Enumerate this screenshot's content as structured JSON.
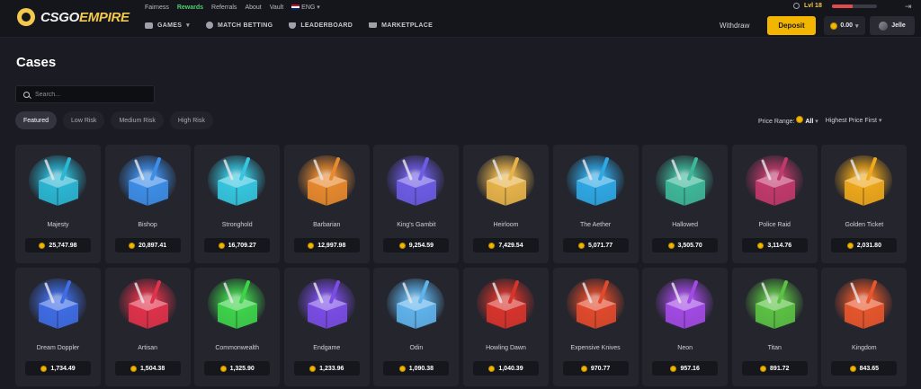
{
  "brand": {
    "name_part1": "CSGO",
    "name_part2": "EMPIRE",
    "accent": "#f2c94c"
  },
  "util_links": {
    "fairness": "Fairness",
    "rewards": "Rewards",
    "referrals": "Referrals",
    "about": "About",
    "vault": "Vault",
    "language": "ENG"
  },
  "nav": {
    "games": "GAMES",
    "match_betting": "MATCH BETTING",
    "leaderboard": "LEADERBOARD",
    "marketplace": "MARKETPLACE"
  },
  "account": {
    "level": "Lvl 18",
    "level_progress": 0.45,
    "withdraw": "Withdraw",
    "deposit": "Deposit",
    "balance": "0.00",
    "username": "Jelle"
  },
  "page": {
    "title": "Cases",
    "search_placeholder": "Search...",
    "filters": [
      "Featured",
      "Low Risk",
      "Medium Risk",
      "High Risk"
    ],
    "active_filter": "Featured",
    "price_range_label": "Price Range:",
    "price_range_value": "All",
    "sort_label": "Highest Price First"
  },
  "cases": [
    {
      "name": "Majesty",
      "price": "25,747.98",
      "color": "#2bb7d4"
    },
    {
      "name": "Bishop",
      "price": "20,897.41",
      "color": "#3d8ee8"
    },
    {
      "name": "Stronghold",
      "price": "16,709.27",
      "color": "#36c6e0"
    },
    {
      "name": "Barbarian",
      "price": "12,997.98",
      "color": "#e88a2e"
    },
    {
      "name": "King's Gambit",
      "price": "9,254.59",
      "color": "#6d5ce6"
    },
    {
      "name": "Heirloom",
      "price": "7,429.54",
      "color": "#e8b44a"
    },
    {
      "name": "The Aether",
      "price": "5,071.77",
      "color": "#2fa8e6"
    },
    {
      "name": "Hallowed",
      "price": "3,505.70",
      "color": "#3fb89a"
    },
    {
      "name": "Police Raid",
      "price": "3,114.76",
      "color": "#c23a6c"
    },
    {
      "name": "Golden Ticket",
      "price": "2,031.80",
      "color": "#f0a81c"
    },
    {
      "name": "Dream Doppler",
      "price": "1,734.49",
      "color": "#3f6de6"
    },
    {
      "name": "Artisan",
      "price": "1,504.38",
      "color": "#e0324a"
    },
    {
      "name": "Commonwealth",
      "price": "1,325.90",
      "color": "#3ed44a"
    },
    {
      "name": "Endgame",
      "price": "1,233.96",
      "color": "#7b4ce6"
    },
    {
      "name": "Odin",
      "price": "1,090.38",
      "color": "#5fb4ec"
    },
    {
      "name": "Howling Dawn",
      "price": "1,040.39",
      "color": "#d8342c"
    },
    {
      "name": "Expensive Knives",
      "price": "970.77",
      "color": "#e24a2c"
    },
    {
      "name": "Neon",
      "price": "957.16",
      "color": "#a34ae6"
    },
    {
      "name": "Titan",
      "price": "891.72",
      "color": "#5cc244"
    },
    {
      "name": "Kingdom",
      "price": "843.65",
      "color": "#e8572c"
    }
  ]
}
